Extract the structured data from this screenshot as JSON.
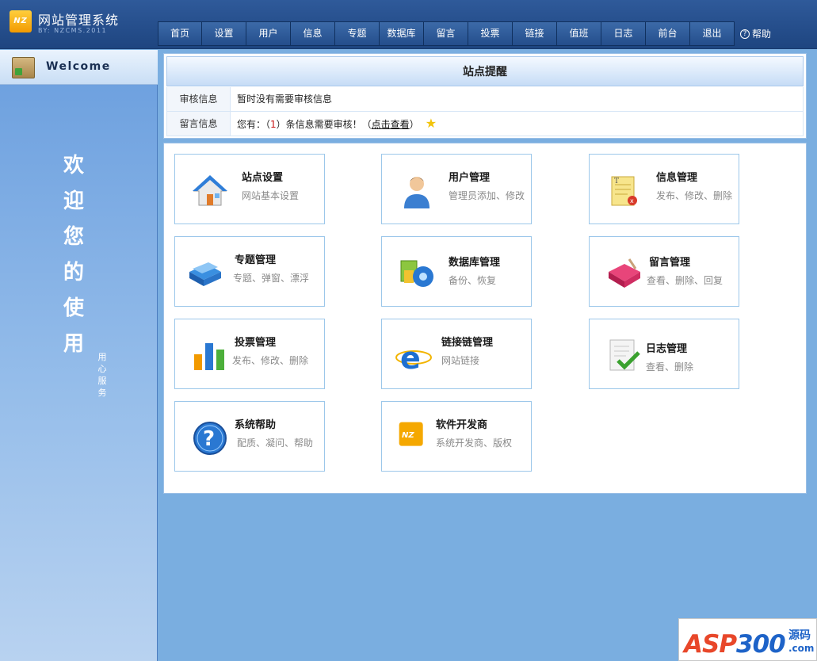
{
  "header": {
    "logo_badge": "NZ",
    "title": "网站管理系统",
    "subtitle": "BY: NZCMS.2011",
    "nav": [
      "首页",
      "设置",
      "用户",
      "信息",
      "专题",
      "数据库",
      "留言",
      "投票",
      "链接",
      "值班",
      "日志",
      "前台",
      "退出"
    ],
    "help_label": "帮助"
  },
  "sidebar": {
    "welcome": "Welcome",
    "slogan_big": [
      "欢",
      "迎",
      "您",
      "的",
      "使",
      "用"
    ],
    "slogan_small": [
      "用",
      "心",
      "服",
      "务"
    ]
  },
  "notice": {
    "title": "站点提醒",
    "review_label": "审核信息",
    "review_value": "暂时没有需要审核信息",
    "message_label": "留言信息",
    "message_prefix": "您有：（",
    "message_count": "1",
    "message_middle": "）条信息需要审核！（",
    "message_link": "点击查看",
    "message_suffix": "）"
  },
  "cards": [
    {
      "title": "站点设置",
      "desc": "网站基本设置",
      "icon": "house-icon"
    },
    {
      "title": "用户管理",
      "desc": "管理员添加、修改",
      "icon": "user-icon"
    },
    {
      "title": "信息管理",
      "desc": "发布、修改、删除",
      "icon": "notepad-icon"
    },
    {
      "title": "专题管理",
      "desc": "专题、弹窗、漂浮",
      "icon": "folders-icon"
    },
    {
      "title": "数据库管理",
      "desc": "备份、恢复",
      "icon": "database-icon"
    },
    {
      "title": "留言管理",
      "desc": "查看、删除、回复",
      "icon": "book-icon"
    },
    {
      "title": "投票管理",
      "desc": "发布、修改、删除",
      "icon": "bar-chart-icon"
    },
    {
      "title": "链接链管理",
      "desc": "网站链接",
      "icon": "ie-icon"
    },
    {
      "title": "日志管理",
      "desc": "查看、删除",
      "icon": "log-check-icon"
    },
    {
      "title": "系统帮助",
      "desc": "配质、凝问、帮助",
      "icon": "help-icon"
    },
    {
      "title": "软件开发商",
      "desc": "系统开发商、版权",
      "icon": "nz-logo-icon"
    }
  ],
  "watermark": {
    "brand_a": "ASP",
    "brand_b": "300",
    "brand_c": "源码",
    "brand_d": ".com"
  },
  "colors": {
    "header_bg": "#2f5a9a",
    "page_bg": "#7aaee0",
    "card_border": "#9cc7ea",
    "accent_orange": "#f29a00"
  }
}
